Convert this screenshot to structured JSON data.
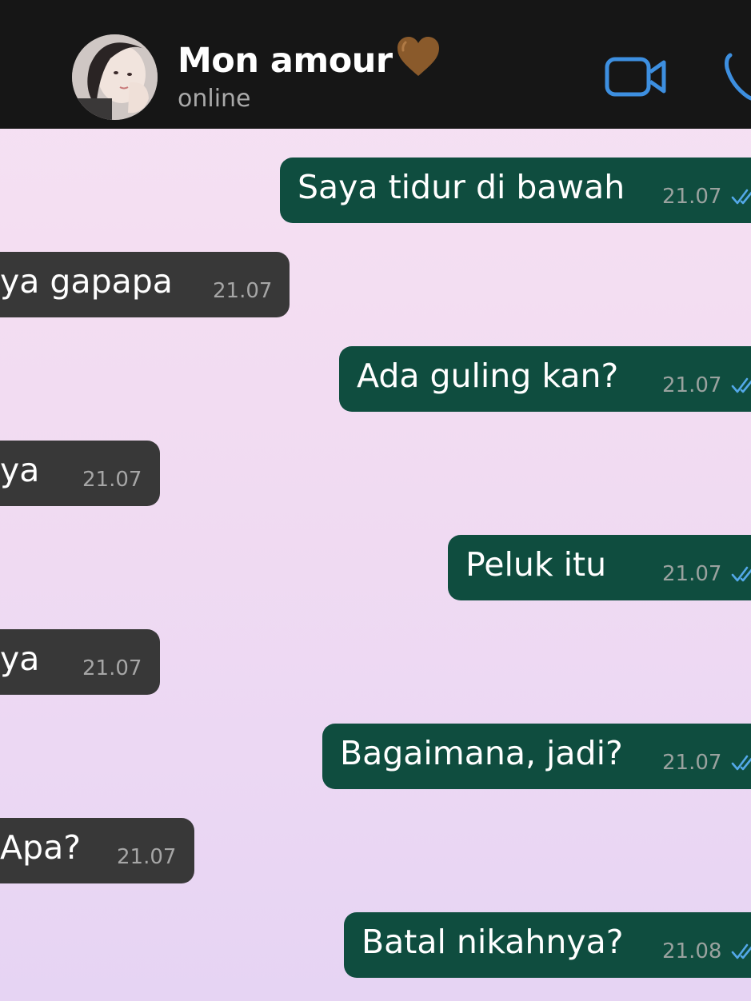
{
  "header": {
    "contact_name": "Mon amour",
    "heart": "🤎",
    "status": "online",
    "avatar_icon": "contact-avatar-photo",
    "video_icon": "video-camera-icon",
    "phone_icon": "phone-icon",
    "accent_color": "#3d8fe0"
  },
  "colors": {
    "outgoing_bubble": "#0f4d3f",
    "incoming_bubble": "#383838",
    "read_tick": "#53a8e8"
  },
  "messages": [
    {
      "direction": "outgoing",
      "text": "Saya tidur di bawah",
      "time": "21.07",
      "status": "read"
    },
    {
      "direction": "incoming",
      "text": "ya gapapa",
      "time": "21.07"
    },
    {
      "direction": "outgoing",
      "text": "Ada guling kan?",
      "time": "21.07",
      "status": "read"
    },
    {
      "direction": "incoming",
      "text": "ya",
      "time": "21.07"
    },
    {
      "direction": "outgoing",
      "text": "Peluk itu",
      "time": "21.07",
      "status": "read"
    },
    {
      "direction": "incoming",
      "text": "ya",
      "time": "21.07"
    },
    {
      "direction": "outgoing",
      "text": "Bagaimana, jadi?",
      "time": "21.07",
      "status": "read"
    },
    {
      "direction": "incoming",
      "text": "Apa?",
      "time": "21.07"
    },
    {
      "direction": "outgoing",
      "text": "Batal nikahnya?",
      "time": "21.08",
      "status": "read"
    }
  ]
}
